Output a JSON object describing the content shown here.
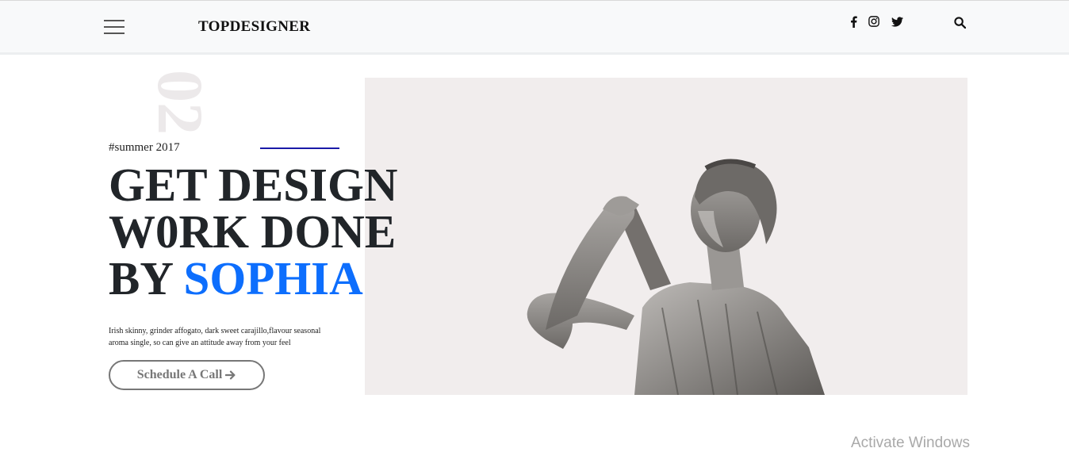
{
  "nav": {
    "brand": "TOPDESIGNER",
    "menu_icon": "hamburger-menu-icon",
    "social": [
      "facebook-icon",
      "instagram-icon",
      "twitter-icon"
    ],
    "search_icon": "search-icon"
  },
  "hero": {
    "slide_number": "02",
    "tag": "#summer 2017",
    "headline_line1": "GET DESIGN",
    "headline_line2": "W0RK DONE",
    "headline_by": "BY ",
    "headline_accent": "SOPHIA",
    "description": "Irish skinny, grinder affogato, dark sweet carajillo,flavour seasonal aroma single, so can give an attitude away from your feel",
    "cta_label": "Schedule A Call",
    "cta_icon": "arrow-right-icon",
    "accent_color": "#0d6efd"
  },
  "watermark": "Activate Windows"
}
